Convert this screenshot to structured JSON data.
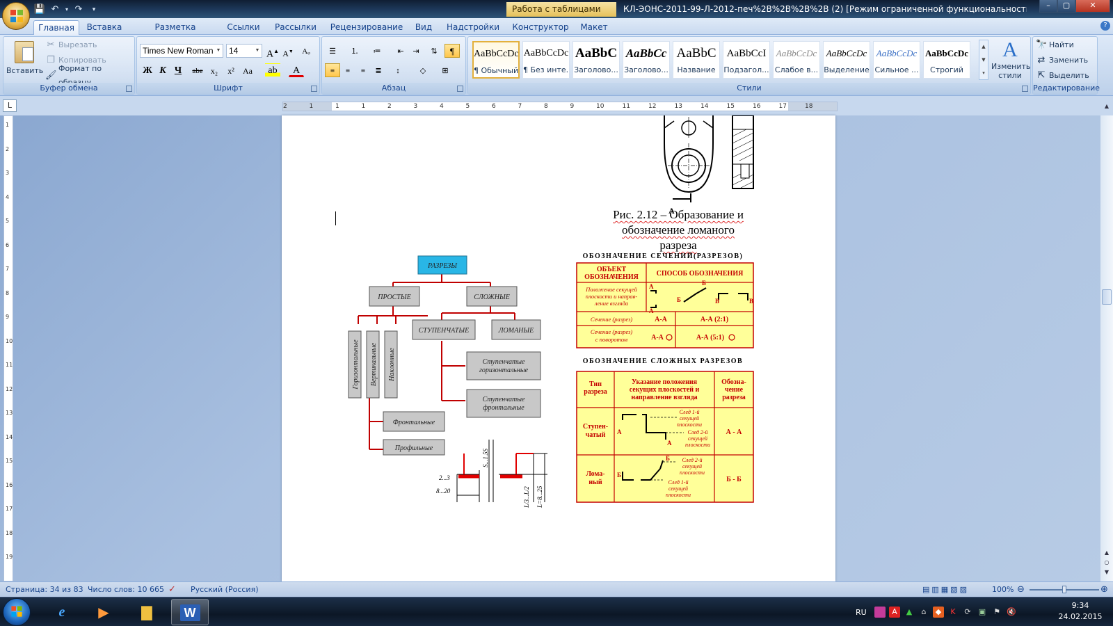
{
  "window": {
    "title": "КЛ-ЭОНС-2011-99-Л-2012-печ%2B%2B%2B%2B (2) [Режим ограниченной функциональности] - Microso...",
    "context_tab": "Работа с таблицами",
    "minimize": "–",
    "maximize": "▢",
    "close": "✕"
  },
  "tabs": [
    "Главная",
    "Вставка",
    "Разметка страницы",
    "Ссылки",
    "Рассылки",
    "Рецензирование",
    "Вид",
    "Надстройки",
    "Конструктор",
    "Макет"
  ],
  "ribbon": {
    "clipboard": {
      "paste": "Вставить",
      "cut": "Вырезать",
      "copy": "Копировать",
      "format_painter": "Формат по образцу",
      "label": "Буфер обмена"
    },
    "font": {
      "name": "Times New Roman",
      "size": "14",
      "bold": "Ж",
      "italic": "К",
      "underline": "Ч",
      "strike": "abe",
      "sub": "x₂",
      "sup": "x²",
      "case": "Aa",
      "label": "Шрифт"
    },
    "paragraph": {
      "label": "Абзац"
    },
    "styles": {
      "label": "Стили",
      "items": [
        {
          "preview": "AaBbCcDc",
          "name": "¶ Обычный"
        },
        {
          "preview": "AaBbCcDc",
          "name": "¶ Без инте..."
        },
        {
          "preview": "AaBbC",
          "name": "Заголово..."
        },
        {
          "preview": "AaBbCc",
          "name": "Заголово..."
        },
        {
          "preview": "AaBbC",
          "name": "Название"
        },
        {
          "preview": "AaBbCcI",
          "name": "Подзагол..."
        },
        {
          "preview": "AaBbCcDc",
          "name": "Слабое в..."
        },
        {
          "preview": "AaBbCcDc",
          "name": "Выделение"
        },
        {
          "preview": "AaBbCcDc",
          "name": "Сильное ..."
        },
        {
          "preview": "AaBbCcDc",
          "name": "Строгий"
        }
      ],
      "change": "Изменить стили"
    },
    "editing": {
      "find": "Найти",
      "replace": "Заменить",
      "select": "Выделить",
      "label": "Редактирование"
    }
  },
  "ruler": {
    "numbers": [
      "2",
      "1",
      "1",
      "1",
      "2",
      "3",
      "4",
      "5",
      "6",
      "7",
      "8",
      "9",
      "10",
      "11",
      "12",
      "13",
      "14",
      "15",
      "16",
      "17",
      "18"
    ]
  },
  "vruler": {
    "numbers": [
      "1",
      "2",
      "3",
      "4",
      "5",
      "6",
      "7",
      "8",
      "9",
      "10",
      "11",
      "12",
      "13",
      "14",
      "15",
      "16",
      "17",
      "18",
      "19"
    ]
  },
  "document": {
    "caption_line1": "Рис. 2.12 – Образование и",
    "caption_line2": "обозначение ломаного",
    "caption_line3": "разреза",
    "section_label": "А",
    "tree": {
      "root": "РАЗРЕЗЫ",
      "simple": "ПРОСТЫЕ",
      "complex": "СЛОЖНЫЕ",
      "stepped": "СТУПЕНЧАТЫЕ",
      "broken": "ЛОМАНЫЕ",
      "horizontal": "Горизонтальные",
      "vertical": "Вертикальные",
      "inclined": "Наклонные",
      "frontal": "Фронтальные",
      "profile": "Профильные",
      "stepped_horiz_1": "Ступенчатые",
      "stepped_horiz_2": "горизонтальные",
      "stepped_front_1": "Ступенчатые",
      "stepped_front_2": "фронтальные"
    },
    "dims": {
      "d1": "2...3",
      "d2": "8...20",
      "d3": "S...1.5S",
      "d4": "L/3...L/2",
      "d5": "L=8...25"
    },
    "table1": {
      "title": "ОБОЗНАЧЕНИЕ СЕЧЕНИЙ(РАЗРЕЗОВ)",
      "h1a": "ОБЪЕКТ",
      "h1b": "ОБОЗНАЧЕНИЯ",
      "h2": "СПОСОБ ОБОЗНАЧЕНИЯ",
      "r1a": "Положение секущей",
      "r1b": "плоскости и направ-",
      "r1c": "ление взгляда",
      "r2": "Сечение (разрез)",
      "r2v1": "А-А",
      "r2v2": "А-А (2:1)",
      "r3a": "Сечение (разрез)",
      "r3b": "с поворотом",
      "r3v1": "А-А",
      "r3v2": "А-А (5:1)",
      "lA": "А",
      "lB": "Б",
      "lV": "В"
    },
    "table2": {
      "title": "ОБОЗНАЧЕНИЕ СЛОЖНЫХ РАЗРЕЗОВ",
      "h1a": "Тип",
      "h1b": "разреза",
      "h2a": "Указание положения",
      "h2b": "секущих плоскостей и",
      "h2c": "направление взгляда",
      "h3a": "Обозна-",
      "h3b": "чение",
      "h3c": "разреза",
      "r1a": "Ступен-",
      "r1b": "чатый",
      "r1v": "А - А",
      "r2a": "Лома-",
      "r2b": "ный",
      "r2v": "Б - Б",
      "n1a": "След 1-й",
      "n1b": "секущей",
      "n1c": "плоскости",
      "n2a": "След 2-й",
      "n2b": "секущей",
      "n2c": "плоскости",
      "lA": "А",
      "lB": "Б"
    }
  },
  "status": {
    "page": "Страница: 34 из 83",
    "words": "Число слов: 10 665",
    "lang": "Русский (Россия)",
    "zoom": "100%"
  },
  "taskbar": {
    "lang": "RU",
    "time": "9:34",
    "date": "24.02.2015"
  },
  "colors": {
    "accent": "#15428b",
    "ribbon_bg": "#c7d8ee",
    "tree_box": "#c8c8c8",
    "root_box": "#29b6e6",
    "table_fill": "#ffff99",
    "table_line": "#c40000"
  }
}
